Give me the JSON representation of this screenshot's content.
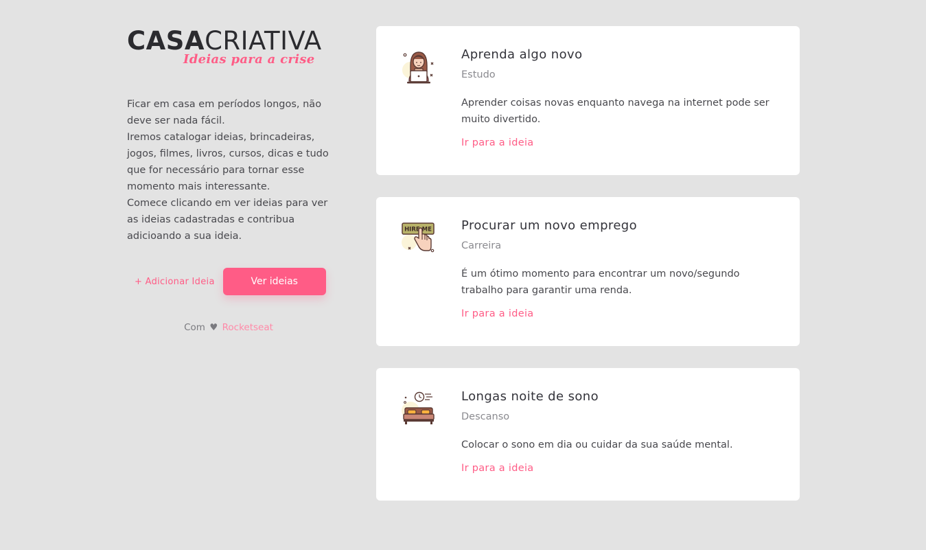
{
  "brand": {
    "logo_part1": "CASA",
    "logo_part2": "CRIATIVA",
    "tagline": "Ideias para a crise"
  },
  "intro": {
    "lines": [
      "Ficar em casa em períodos longos, não deve ser nada fácil.",
      "Iremos catalogar ideias, brincadeiras, jogos, filmes, livros, cursos, dicas e tudo que for necessário para tornar esse momento mais interessante.",
      "Comece clicando em ver ideias para ver as ideias cadastradas e contribua adicioando a sua ideia."
    ]
  },
  "actions": {
    "add_label": "+ Adicionar Ideia",
    "view_label": "Ver ideias"
  },
  "credits": {
    "prefix": "Com",
    "heart": "♥",
    "brand": "Rocketseat"
  },
  "cards": [
    {
      "icon": "student-laptop-icon",
      "title": "Aprenda algo novo",
      "category": "Estudo",
      "description": "Aprender coisas novas enquanto navega na internet pode ser muito divertido.",
      "link": "Ir para a ideia"
    },
    {
      "icon": "hire-me-icon",
      "icon_text": "HIRE ME",
      "title": "Procurar um novo emprego",
      "category": "Carreira",
      "description": "É um ótimo momento para encontrar um novo/segundo trabalho para garantir uma renda.",
      "link": "Ir para a ideia"
    },
    {
      "icon": "bed-clock-icon",
      "title": "Longas noite de sono",
      "category": "Descanso",
      "description": "Colocar o sono em dia ou cuidar da sua saúde mental.",
      "link": "Ir para a ideia"
    }
  ],
  "colors": {
    "background": "#e3e3e3",
    "accent": "#ff5c86",
    "card": "#ffffff",
    "text": "#48484d"
  }
}
